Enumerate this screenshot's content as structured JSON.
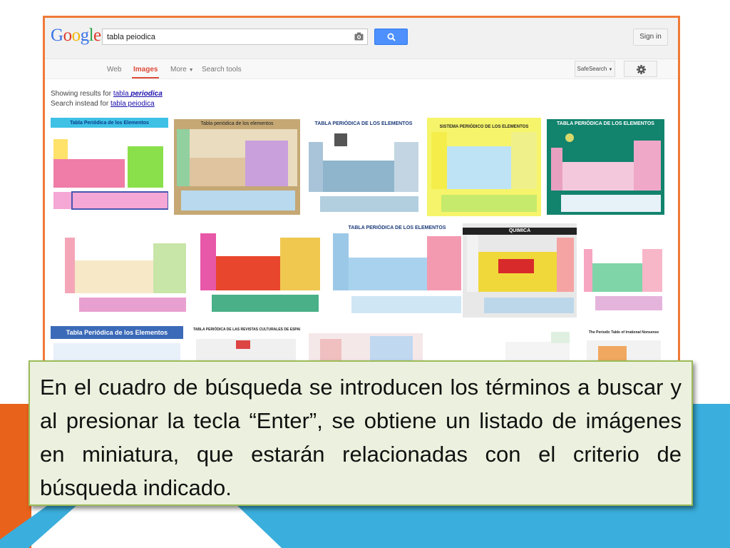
{
  "google": {
    "logo": "Google",
    "search_value": "tabla peiodica",
    "signin_label": "Sign in",
    "nav": [
      "Web",
      "Images",
      "More",
      "Search tools"
    ],
    "active_tab": "Images",
    "safesearch_label": "SafeSearch",
    "showing_prefix": "Showing results for",
    "showing_term_plain": "tabla",
    "showing_term_bold": "periodica",
    "instead_prefix": "Search instead for",
    "instead_term": "tabla peiodica",
    "colors": {
      "active": "#dd4b39",
      "button": "#4d90fe",
      "link": "#1a0dab",
      "frame": "#f07a38"
    }
  },
  "thumbnails": [
    {
      "title": "Tabla Periódica de los Elementos"
    },
    {
      "title": "Tabla periódica de los elementos"
    },
    {
      "title": "TABLA PERIÓDICA DE LOS ELEMENTOS"
    },
    {
      "title": "SISTEMA PERIÓDICO DE LOS ELEMENTOS"
    },
    {
      "title": "TABLA PERIÓDICA DE LOS ELEMENTOS"
    },
    {
      "title": ""
    },
    {
      "title": ""
    },
    {
      "title": "TABLA PERIÓDICA DE LOS ELEMENTOS"
    },
    {
      "title": "QUIMICA"
    },
    {
      "title": ""
    },
    {
      "title": "Tabla Periódica de los Elementos"
    },
    {
      "title": "TABLA PERIÓDICA DE LAS REVISTAS CULTURALES DE ESPAÑA"
    },
    {
      "title": ""
    },
    {
      "title": ""
    },
    {
      "title": "The Periodic Table of Irrational Nonsense"
    }
  ],
  "caption": "En el cuadro de búsqueda se introducen los términos a buscar y al presionar la tecla “Enter”, se obtiene un listado de imágenes  en miniatura, que estarán relacionadas con el criterio de búsqueda indicado.",
  "slide_colors": {
    "orange": "#e8621c",
    "blue": "#3aaedc",
    "caption_bg": "#ebf1de",
    "caption_border": "#9cbb58"
  }
}
